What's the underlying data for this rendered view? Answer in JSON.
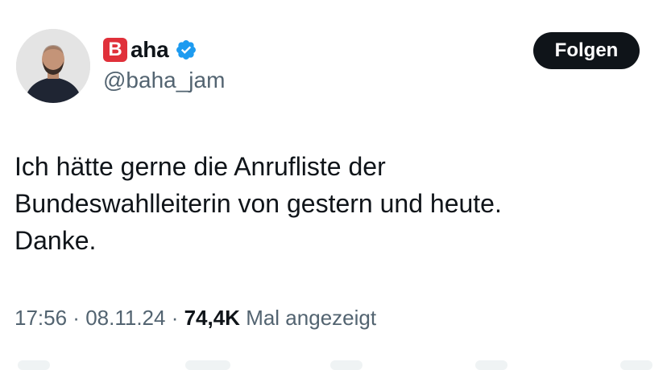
{
  "tweet": {
    "author": {
      "badge_letter": "B",
      "display_name": "aha",
      "handle": "@baha_jam",
      "verified": true
    },
    "follow_label": "Folgen",
    "text": "Ich hätte gerne die Anrufliste der\nBundeswahlleiterin von gestern und heute.\nDanke.",
    "meta": {
      "time": "17:56",
      "sep1": " · ",
      "date": "08.11.24",
      "sep2": " · ",
      "views": "74,4K",
      "views_label": " Mal angezeigt"
    }
  },
  "colors": {
    "text": "#0f1419",
    "secondary": "#536471",
    "verified_blue": "#1d9bf0",
    "badge_red": "#e0303a",
    "button_bg": "#0f1419"
  },
  "icons": {
    "avatar": "profile-photo",
    "verified": "verified-badge-icon",
    "badge": "b-button-emoji"
  }
}
